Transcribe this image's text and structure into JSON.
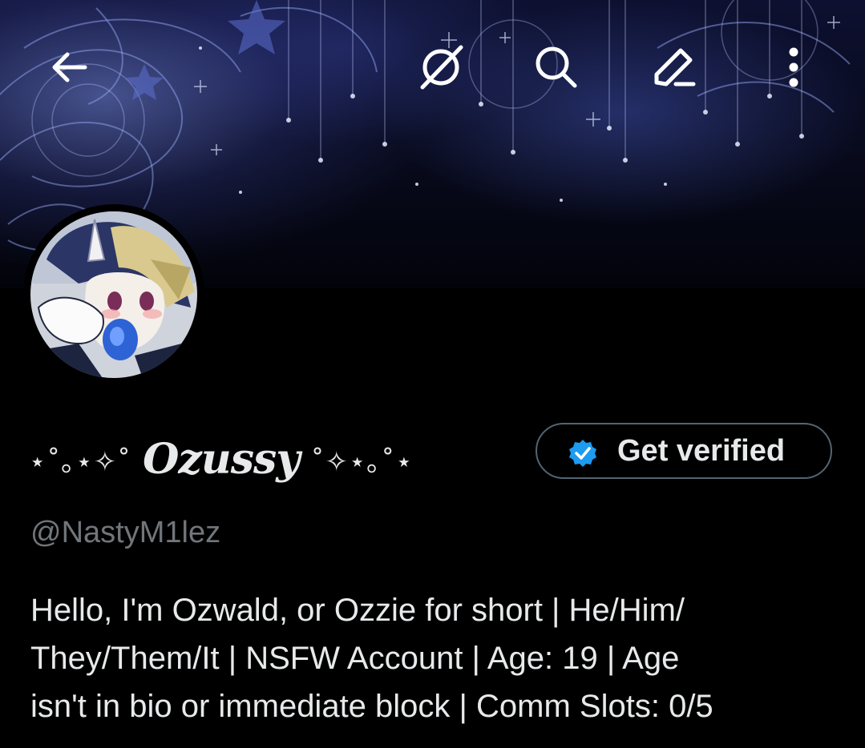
{
  "header": {
    "back_icon": "arrow-left-icon",
    "actions": [
      {
        "icon": "grok-icon"
      },
      {
        "icon": "search-icon"
      },
      {
        "icon": "edit-icon"
      },
      {
        "icon": "more-vertical-icon"
      }
    ]
  },
  "profile": {
    "display_name_prefix": "⋆˚｡⋆✧˚",
    "display_name": "Ozussy",
    "display_name_suffix": "˚✧⋆｡˚⋆",
    "handle": "@NastyM1lez",
    "bio_lines": [
      "Hello, I'm Ozwald, or Ozzie for short | He/Him/",
      "They/Them/It | NSFW Account | Age: 19 | Age",
      "isn't in bio or immediate block | Comm Slots: 0/5"
    ]
  },
  "verify_button": {
    "label": "Get verified",
    "badge_color": "#1d9bf0"
  },
  "colors": {
    "background": "#000000",
    "text_primary": "#e7e9ea",
    "text_secondary": "#71767b",
    "border": "#536471"
  }
}
